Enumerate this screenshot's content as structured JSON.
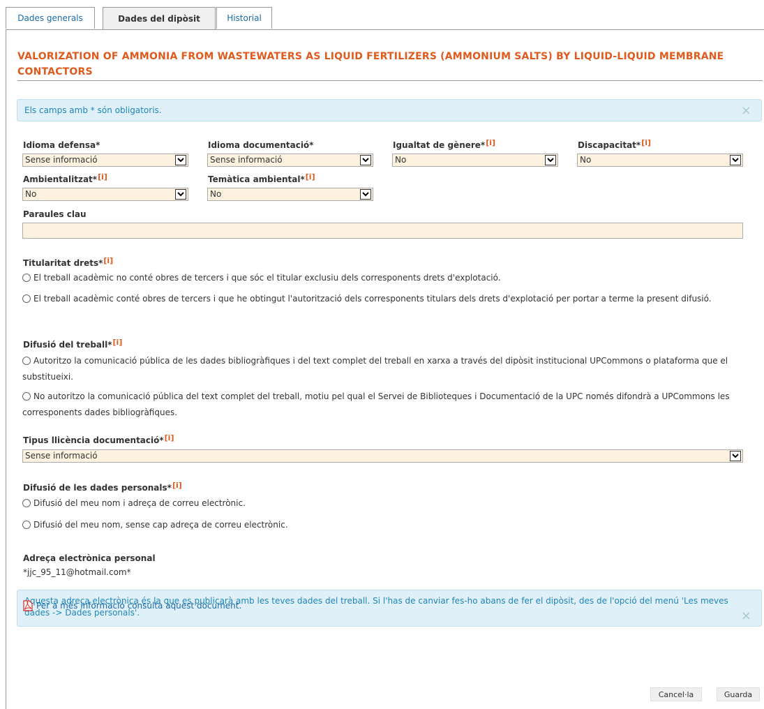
{
  "tabs": [
    {
      "label": "Dades generals"
    },
    {
      "label": "Dades del dipòsit"
    },
    {
      "label": "Historial"
    }
  ],
  "title": "VALORIZATION OF AMMONIA FROM WASTEWATERS AS LIQUID FERTILIZERS (AMMONIUM SALTS) BY LIQUID-LIQUID MEMBRANE CONTACTORS",
  "required_notice": "Els camps amb * són obligatoris.",
  "close_symbol": "×",
  "info_marker": "[i]",
  "fields": {
    "idioma_defensa": {
      "label": "Idioma defensa*",
      "value": "Sense informació"
    },
    "idioma_documentacio": {
      "label": "Idioma documentació*",
      "value": "Sense informació"
    },
    "igualtat_genere": {
      "label": "Igualtat de gènere*",
      "value": "No"
    },
    "discapacitat": {
      "label": "Discapacitat*",
      "value": "No"
    },
    "ambientalitzat": {
      "label": "Ambientalitzat*",
      "value": "No"
    },
    "tematica_ambiental": {
      "label": "Temàtica ambiental*",
      "value": "No"
    },
    "paraules_clau": {
      "label": "Paraules clau",
      "value": ""
    }
  },
  "titularitat": {
    "label": "Titularitat drets*",
    "options": [
      "El treball acadèmic no conté obres de tercers i que sóc el titular exclusiu dels corresponents drets d'explotació.",
      "El treball acadèmic conté obres de tercers i que he obtingut l'autorització dels corresponents titulars dels drets d'explotació per portar a terme la present difusió."
    ]
  },
  "difusio_treball": {
    "label": "Difusió del treball*",
    "options": [
      "Autoritzo la comunicació pública de les dades bibliogràfiques i del text complet del treball en xarxa a través del dipòsit institucional UPCommons o plataforma que el substitueixi.",
      "No autoritzo la comunicació pública del text complet del treball, motiu pel qual el Servei de Biblioteques i Documentació de la UPC només difondrà a UPCommons les corresponents dades bibliogràfiques."
    ]
  },
  "llicencia": {
    "label": "Tipus llicència documentació*",
    "value": "Sense informació"
  },
  "dades_personals": {
    "label": "Difusió de les dades personals*",
    "options": [
      "Difusió del meu nom i adreça de correu electrònic.",
      "Difusió del meu nom, sense cap adreça de correu electrònic."
    ]
  },
  "email": {
    "label": "Adreça electrònica personal",
    "value": "*jjc_95_11@hotmail.com*"
  },
  "email_notice": "Aquesta adreça electrònica és la que es publicarà amb les teves dades del treball. Si l'has de canviar fes-ho abans de fer el dipòsit, des de l'opció del menú 'Les meves dades -> Dades personals'.",
  "more_info_link": "Per a més informació consulta aquest document.",
  "buttons": {
    "cancel": "Cancel·la",
    "save": "Guarda"
  },
  "colors": {
    "accent": "#e05a1e",
    "link": "#1a6aa8",
    "alert_bg": "#dff0f8",
    "field_bg": "#fdf1e0"
  }
}
